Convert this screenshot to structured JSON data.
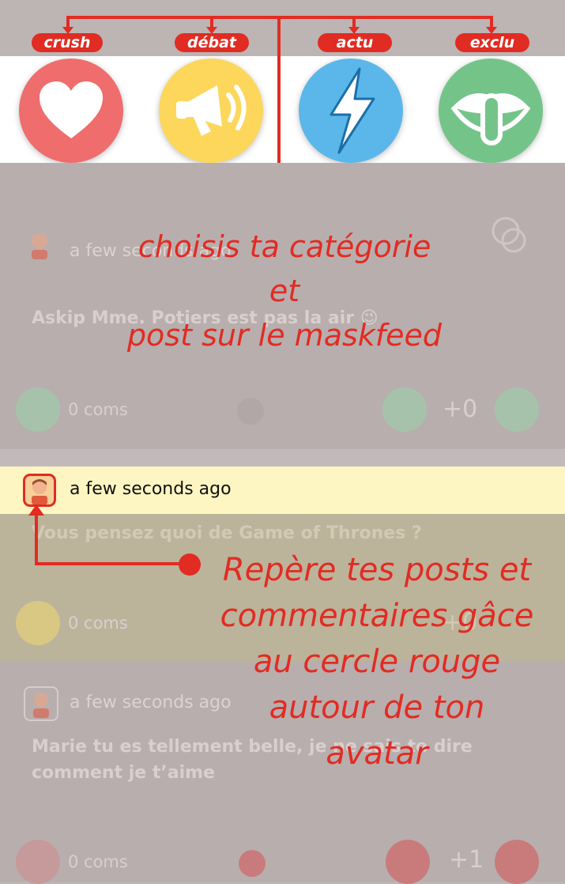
{
  "categories": [
    {
      "label": "crush",
      "icon": "heart-icon",
      "color": "#ef6d6d"
    },
    {
      "label": "débat",
      "icon": "megaphone-icon",
      "color": "#fdd75c"
    },
    {
      "label": "actu",
      "icon": "lightning-icon",
      "color": "#5bb7ea"
    },
    {
      "label": "exclu",
      "icon": "secret-lips-icon",
      "color": "#74c48a"
    }
  ],
  "posts": [
    {
      "time": "a few seconds ago",
      "text": "Askip Mme. Potiers est pas la air 😉",
      "coms": "0 coms",
      "score": "+0"
    },
    {
      "time": "a few seconds ago",
      "text": "Vous pensez quoi de Game of Thrones ?",
      "coms": "0 coms",
      "score": "+0"
    },
    {
      "time": "a few seconds ago",
      "text": "Marie tu es tellement belle, je ne sais te dire comment je t’aime",
      "coms": "0 coms",
      "score": "+1"
    }
  ],
  "annotations": {
    "top_lines": [
      "choisis ta catégorie",
      "et",
      "post sur le maskfeed"
    ],
    "bottom_lines": [
      "Repère tes posts et",
      "commentaires gâce",
      "au cercle rouge",
      "autour de ton",
      "avatar"
    ]
  },
  "colors": {
    "accent": "#e22b22",
    "highlight": "#fdf6c2",
    "overlay": "#bdb4b4"
  }
}
